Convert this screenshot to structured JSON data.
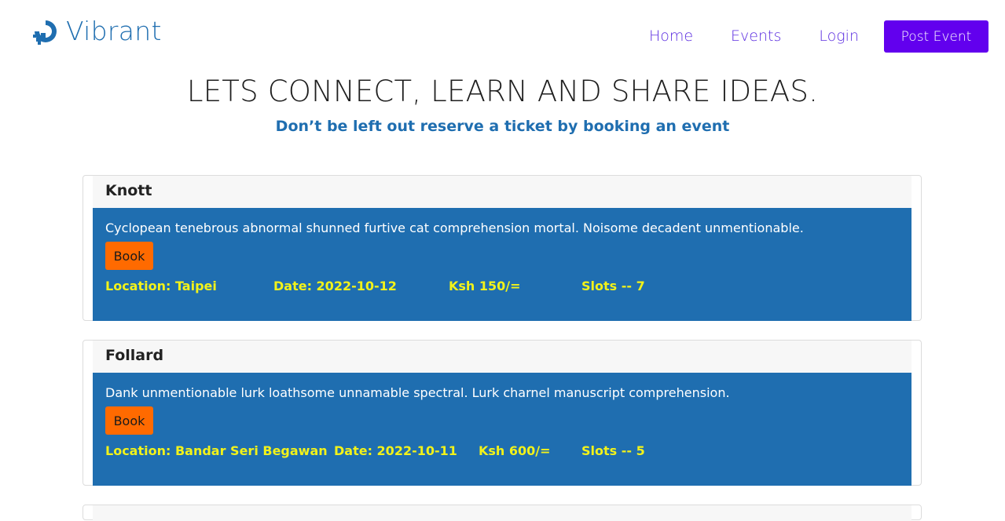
{
  "brand": {
    "name": "Vibrant",
    "color": "#1f6eb0",
    "icon": "vibrant-logo-icon"
  },
  "nav": {
    "links": [
      "Home",
      "Events",
      "Login"
    ],
    "post_button": "Post Event",
    "link_color": "#5b2de0",
    "button_color": "#6200ee"
  },
  "hero": {
    "title": "LETS CONNECT, LEARN AND SHARE IDEAS.",
    "subtitle": "Don’t be left out reserve a ticket by booking an event"
  },
  "events": [
    {
      "title": "Knott",
      "description": "Cyclopean tenebrous abnormal shunned furtive cat comprehension mortal. Noisome decadent unmentionable.",
      "book_label": "Book",
      "location": "Location: Taipei",
      "date": "Date: 2022-10-12",
      "price": "Ksh 150/=",
      "slots": "Slots -- 7"
    },
    {
      "title": "Follard",
      "description": "Dank unmentionable lurk loathsome unnamable spectral. Lurk charnel manuscript comprehension.",
      "book_label": "Book",
      "location": "Location: Bandar Seri Begawan",
      "date": "Date: 2022-10-11",
      "price": "Ksh 600/=",
      "slots": "Slots -- 5"
    }
  ],
  "colors": {
    "card_body": "#1f6eb0",
    "book_button": "#ff6a00",
    "meta_text": "#f2f21a"
  }
}
